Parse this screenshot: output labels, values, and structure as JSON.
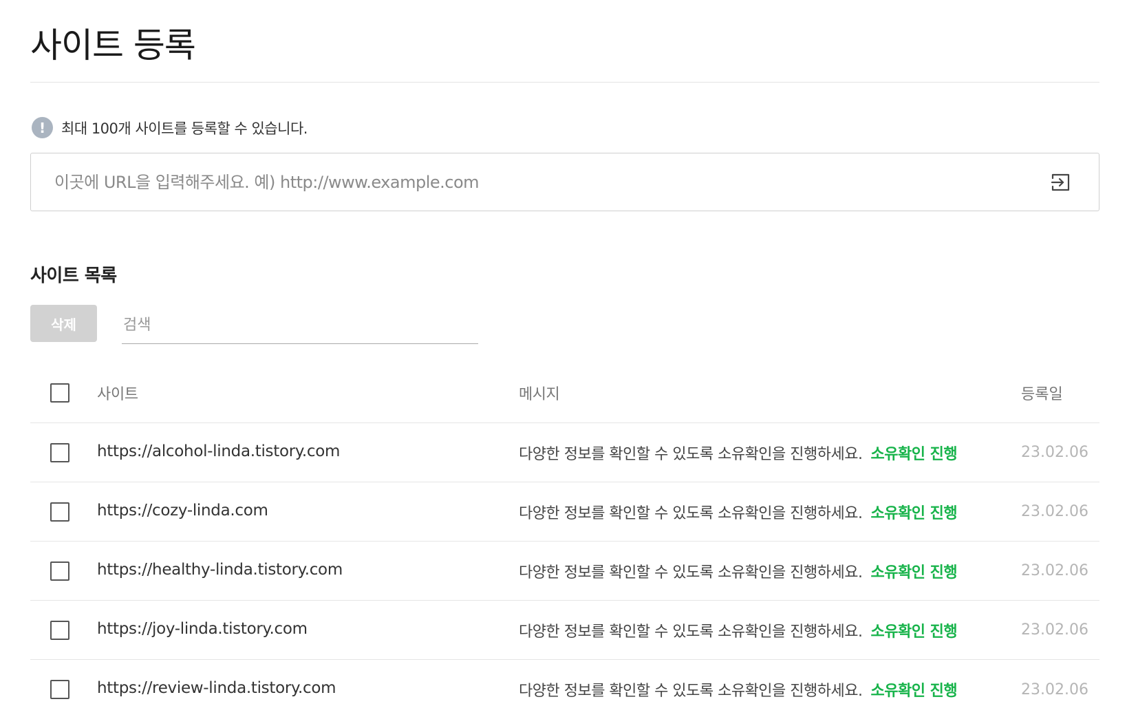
{
  "page": {
    "title": "사이트 등록"
  },
  "notice": {
    "icon": "exclamation-icon",
    "text": "최대 100개 사이트를 등록할 수 있습니다."
  },
  "url_input": {
    "value": "",
    "placeholder": "이곳에 URL을 입력해주세요. 예) http://www.example.com",
    "submit_icon": "enter-arrow-icon"
  },
  "site_list": {
    "title": "사이트 목록",
    "delete_label": "삭제",
    "search_placeholder": "검색",
    "columns": {
      "site": "사이트",
      "message": "메시지",
      "date": "등록일"
    },
    "rows": [
      {
        "site": "https://alcohol-linda.tistory.com",
        "message": "다양한 정보를 확인할 수 있도록 소유확인을 진행하세요.",
        "action": "소유확인 진행",
        "date": "23.02.06"
      },
      {
        "site": "https://cozy-linda.com",
        "message": "다양한 정보를 확인할 수 있도록 소유확인을 진행하세요.",
        "action": "소유확인 진행",
        "date": "23.02.06"
      },
      {
        "site": "https://healthy-linda.tistory.com",
        "message": "다양한 정보를 확인할 수 있도록 소유확인을 진행하세요.",
        "action": "소유확인 진행",
        "date": "23.02.06"
      },
      {
        "site": "https://joy-linda.tistory.com",
        "message": "다양한 정보를 확인할 수 있도록 소유확인을 진행하세요.",
        "action": "소유확인 진행",
        "date": "23.02.06"
      },
      {
        "site": "https://review-linda.tistory.com",
        "message": "다양한 정보를 확인할 수 있도록 소유확인을 진행하세요.",
        "action": "소유확인 진행",
        "date": "23.02.06"
      }
    ]
  },
  "colors": {
    "action_green": "#17b34a",
    "disabled_button": "#d2d2d2",
    "notice_icon": "#aab4c0"
  }
}
